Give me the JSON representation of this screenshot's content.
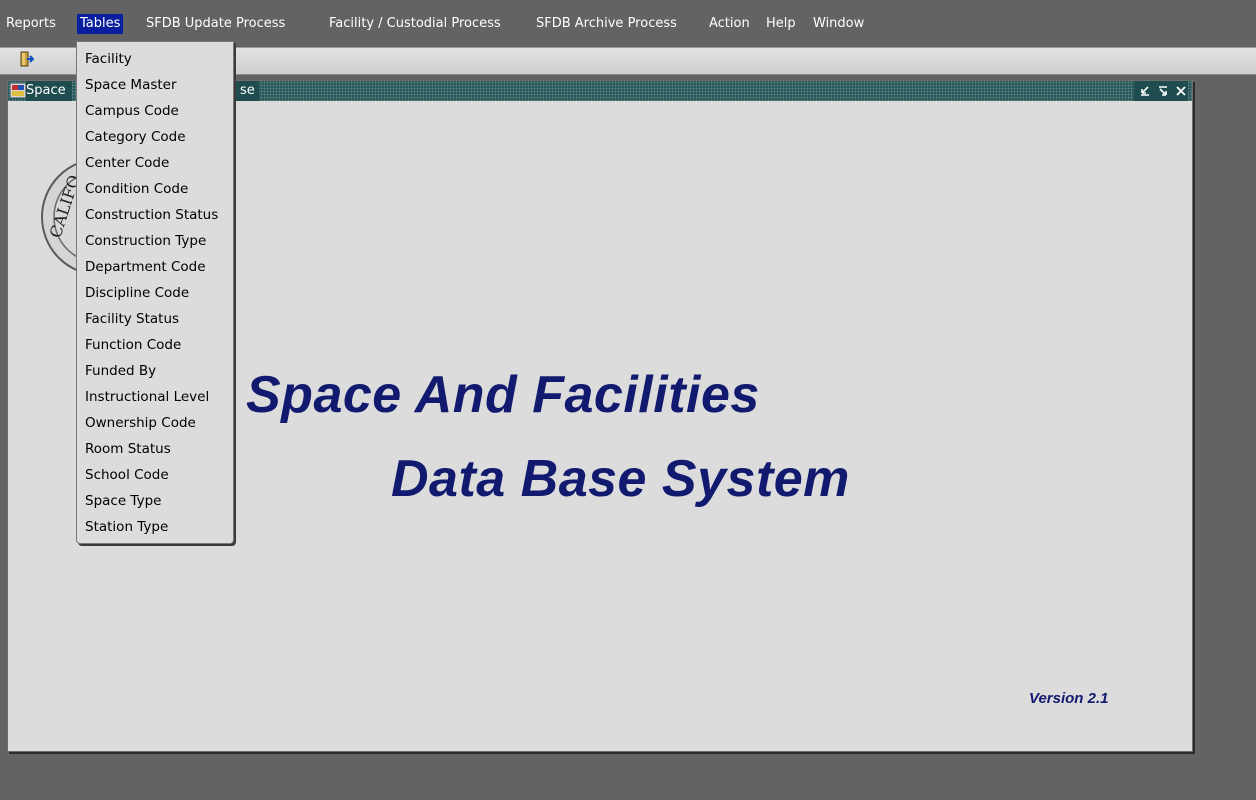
{
  "menubar": {
    "items": [
      {
        "label": "Reports"
      },
      {
        "label": "Tables"
      },
      {
        "label": "SFDB Update Process"
      },
      {
        "label": "Facility / Custodial Process"
      },
      {
        "label": "SFDB Archive Process"
      },
      {
        "label": "Action"
      },
      {
        "label": "Help"
      },
      {
        "label": "Window"
      }
    ]
  },
  "toolbar": {
    "exit_icon": "exit-door-icon"
  },
  "window": {
    "title": "Space",
    "title_tail": "se",
    "controls": [
      "minimize-icon",
      "maximize-icon",
      "close-icon"
    ],
    "heading_line1": "Space And Facilities",
    "heading_line2": "Data Base System",
    "version": "Version 2.1",
    "seal_text": "CALIFO"
  },
  "dropdown": {
    "items": [
      {
        "label": "Facility"
      },
      {
        "label": "Space Master"
      },
      {
        "label": "Campus Code"
      },
      {
        "label": "Category Code"
      },
      {
        "label": "Center Code"
      },
      {
        "label": "Condition Code"
      },
      {
        "label": "Construction Status"
      },
      {
        "label": "Construction Type"
      },
      {
        "label": "Department Code"
      },
      {
        "label": "Discipline Code"
      },
      {
        "label": "Facility Status"
      },
      {
        "label": "Function Code"
      },
      {
        "label": "Funded By"
      },
      {
        "label": "Instructional Level"
      },
      {
        "label": "Ownership Code"
      },
      {
        "label": "Room Status"
      },
      {
        "label": "School Code"
      },
      {
        "label": "Space Type"
      },
      {
        "label": "Station Type"
      }
    ]
  },
  "colors": {
    "desktop": "#636363",
    "menu_highlight": "#0a1f9e",
    "heading": "#111a6e",
    "titlebar": "#1f4d4f"
  }
}
